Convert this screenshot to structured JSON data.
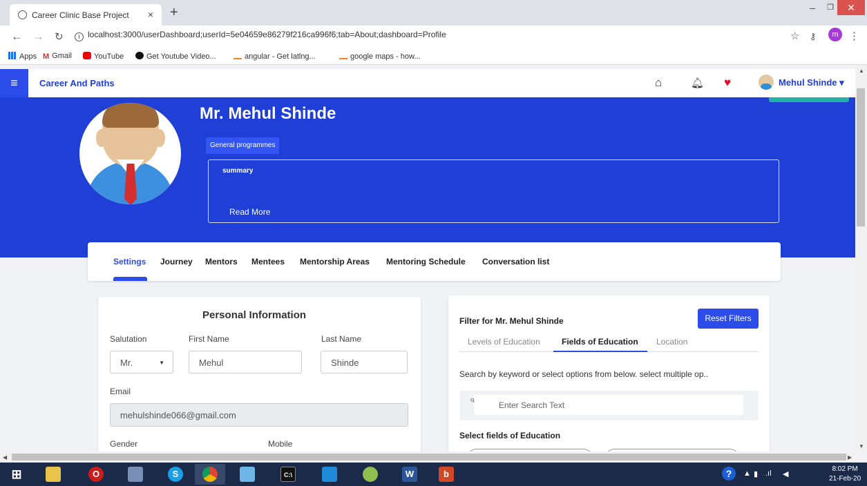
{
  "browser": {
    "tab_title": "Career Clinic Base Project",
    "tab_close": "×",
    "new_tab": "+",
    "url": "localhost:3000/userDashboard;userId=5e04659e86279f216ca996f6;tab=About;dashboard=Profile",
    "profile_initial": "m",
    "bookmarks": [
      "Apps",
      "Gmail",
      "YouTube",
      "Get Youtube Video...",
      "angular - Get latlng...",
      "google maps - how..."
    ]
  },
  "header": {
    "brand": "Career And Paths",
    "user_name": "Mehul Shinde ▾"
  },
  "profile": {
    "name": "Mr. Mehul Shinde",
    "badge": "General programmes",
    "summary_title": "summary",
    "read_more": "Read More"
  },
  "profile_tabs": [
    "Settings",
    "Journey",
    "Mentors",
    "Mentees",
    "Mentorship Areas",
    "Mentoring Schedule",
    "Conversation list"
  ],
  "personal_info": {
    "title": "Personal Information",
    "salutation_label": "Salutation",
    "salutation_value": "Mr.",
    "first_name_label": "First Name",
    "first_name_value": "Mehul",
    "last_name_label": "Last Name",
    "last_name_value": "Shinde",
    "email_label": "Email",
    "email_value": "mehulshinde066@gmail.com",
    "gender_label": "Gender",
    "mobile_label": "Mobile"
  },
  "filter": {
    "title": "Filter for Mr. Mehul Shinde",
    "reset_label": "Reset Filters",
    "tabs": [
      "Levels of Education",
      "Fields of Education",
      "Location"
    ],
    "active_tab": "Fields of Education",
    "hint": "Search by keyword or select options from below. select multiple op..",
    "search_placeholder": "Enter Search Text",
    "subheading": "Select fields of Education"
  },
  "taskbar": {
    "time": "8:02 PM",
    "date": "21-Feb-20"
  },
  "colors": {
    "primary": "#1f3fd6",
    "accent": "#2b4ce8",
    "teal": "#22b0a6",
    "heart": "#e0102a"
  }
}
